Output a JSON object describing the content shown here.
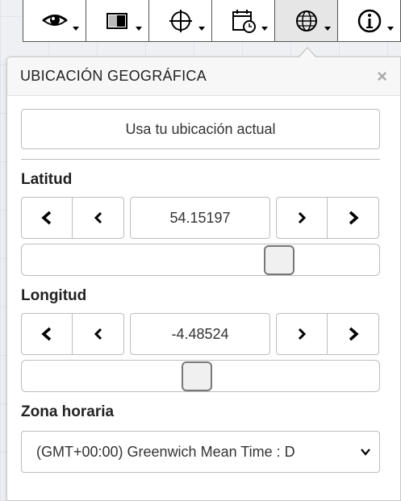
{
  "toolbar": {
    "buttons": [
      {
        "icon": "eye-icon"
      },
      {
        "icon": "contrast-icon"
      },
      {
        "icon": "crosshair-icon"
      },
      {
        "icon": "calendar-clock-icon"
      },
      {
        "icon": "globe-icon",
        "active": true
      },
      {
        "icon": "info-icon"
      }
    ]
  },
  "panel": {
    "title": "UBICACIÓN GEOGRÁFICA",
    "close_glyph": "×",
    "use_location_label": "Usa tu ubicación actual",
    "latitude": {
      "label": "Latitud",
      "value": "54.15197",
      "slider_fraction": 0.74
    },
    "longitude": {
      "label": "Longitud",
      "value": "-4.48524",
      "slider_fraction": 0.49
    },
    "timezone": {
      "label": "Zona horaria",
      "selected": "(GMT+00:00) Greenwich Mean Time : D"
    },
    "step_glyphs": {
      "prev_fast": "❮",
      "prev": "‹",
      "next": "›",
      "next_fast": "❯"
    }
  },
  "colors": {
    "border": "#bdbdbd",
    "header_bg": "#f7f7f7",
    "active_tab": "#e6e6e6"
  }
}
